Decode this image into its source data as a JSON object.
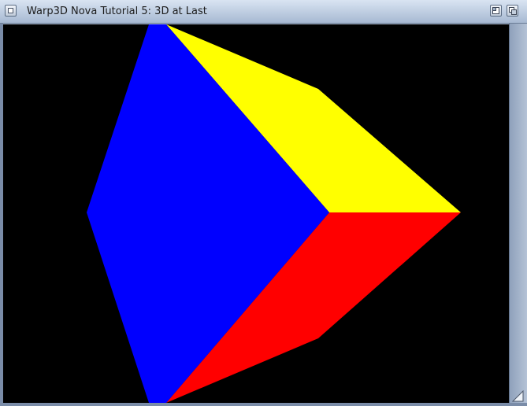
{
  "window": {
    "title": "Warp3D Nova Tutorial 5: 3D at Last",
    "icons": {
      "close": "close-gadget-icon",
      "zoom": "zoom-gadget-icon",
      "depth": "depth-gadget-icon",
      "resize": "resize-gadget-icon"
    }
  },
  "scene": {
    "background": "#000000",
    "faces": [
      {
        "name": "front-face",
        "color": "#0000ff"
      },
      {
        "name": "top-face",
        "color": "#ffff00"
      },
      {
        "name": "right-face",
        "color": "#ff0000"
      }
    ]
  }
}
